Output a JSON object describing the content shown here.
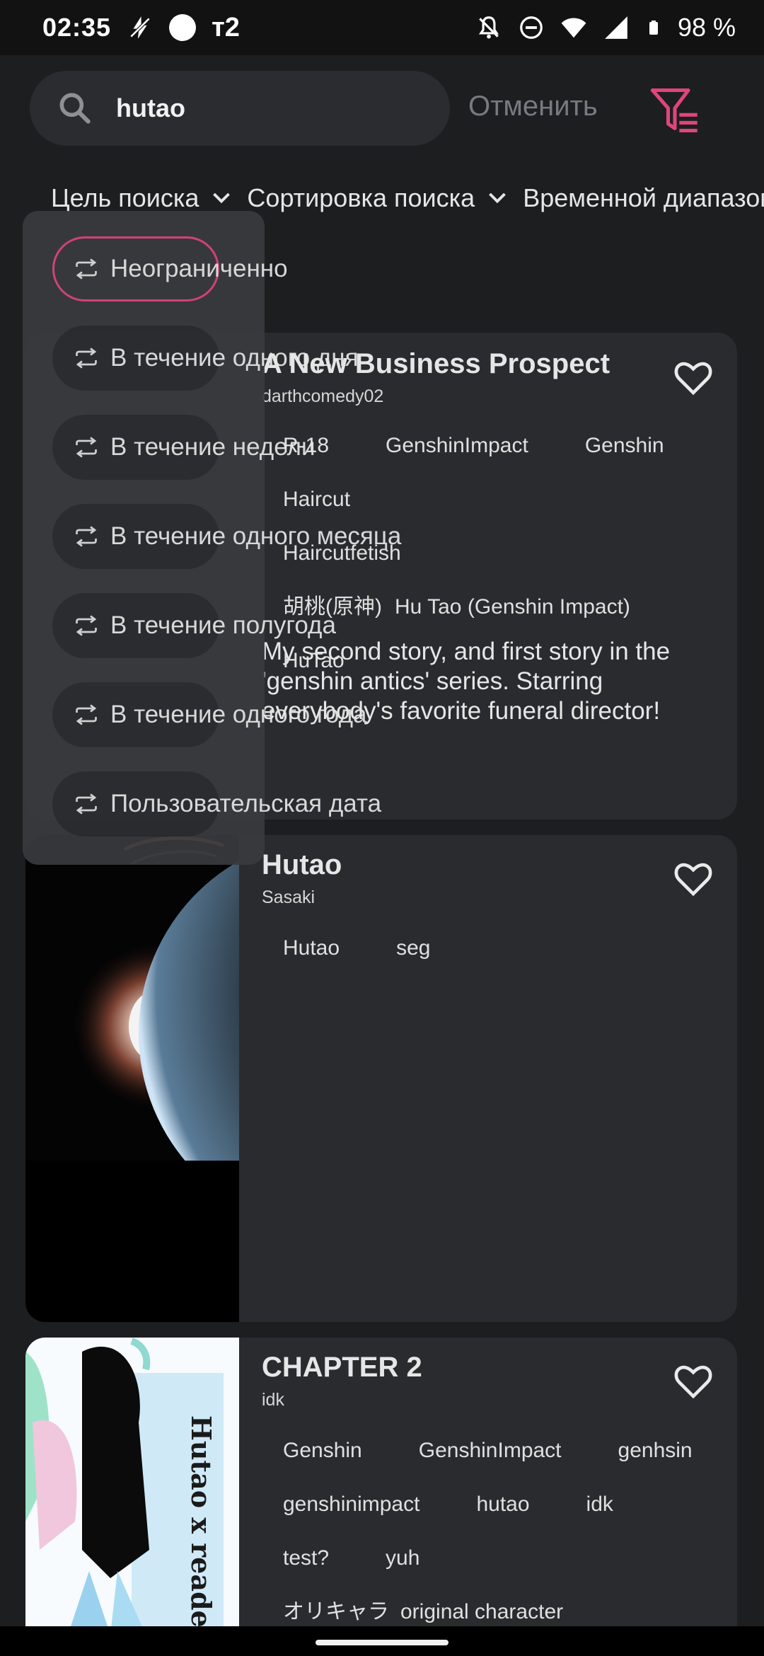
{
  "status_bar": {
    "time": "02:35",
    "carrier": "т2",
    "battery": "98 %"
  },
  "search": {
    "query": "hutao",
    "cancel_label": "Отменить"
  },
  "filters": [
    {
      "label": "Цель поиска"
    },
    {
      "label": "Сортировка поиска"
    },
    {
      "label": "Временной диапазон"
    }
  ],
  "time_dropdown": {
    "options": [
      {
        "label": "Неограниченно"
      },
      {
        "label": "В течение одного дня"
      },
      {
        "label": "В течение недели"
      },
      {
        "label": "В течение одного месяца"
      },
      {
        "label": "В течение полугода"
      },
      {
        "label": "В течение одного года"
      },
      {
        "label": "Пользовательская дата"
      }
    ],
    "selected_index": 0
  },
  "cards": [
    {
      "title": "A New Business Prospect",
      "author": "darthcomedy02",
      "tags": [
        "R-18",
        "GenshinImpact",
        "Genshin",
        "Haircut",
        "Haircutfetish",
        "胡桃(原神)",
        "Hu Tao (Genshin Impact)",
        "HuTao"
      ],
      "description": "My second story, and first story in the 'genshin antics' series. Starring everybody's favorite funeral director!"
    },
    {
      "title": "Hutao",
      "author": "Sasaki",
      "tags": [
        "Hutao",
        "seg"
      ],
      "description": ""
    },
    {
      "title": "CHAPTER 2",
      "author": "idk",
      "tags": [
        "Genshin",
        "GenshinImpact",
        "genhsin",
        "genshinimpact",
        "hutao",
        "idk",
        "test?",
        "yuh",
        "オリキャラ",
        "original character"
      ],
      "description": "",
      "cover_text": "Hutao x reade"
    }
  ],
  "colors": {
    "accent": "#e0457a",
    "background": "#1d1e20",
    "card": "#2a2b2e"
  }
}
